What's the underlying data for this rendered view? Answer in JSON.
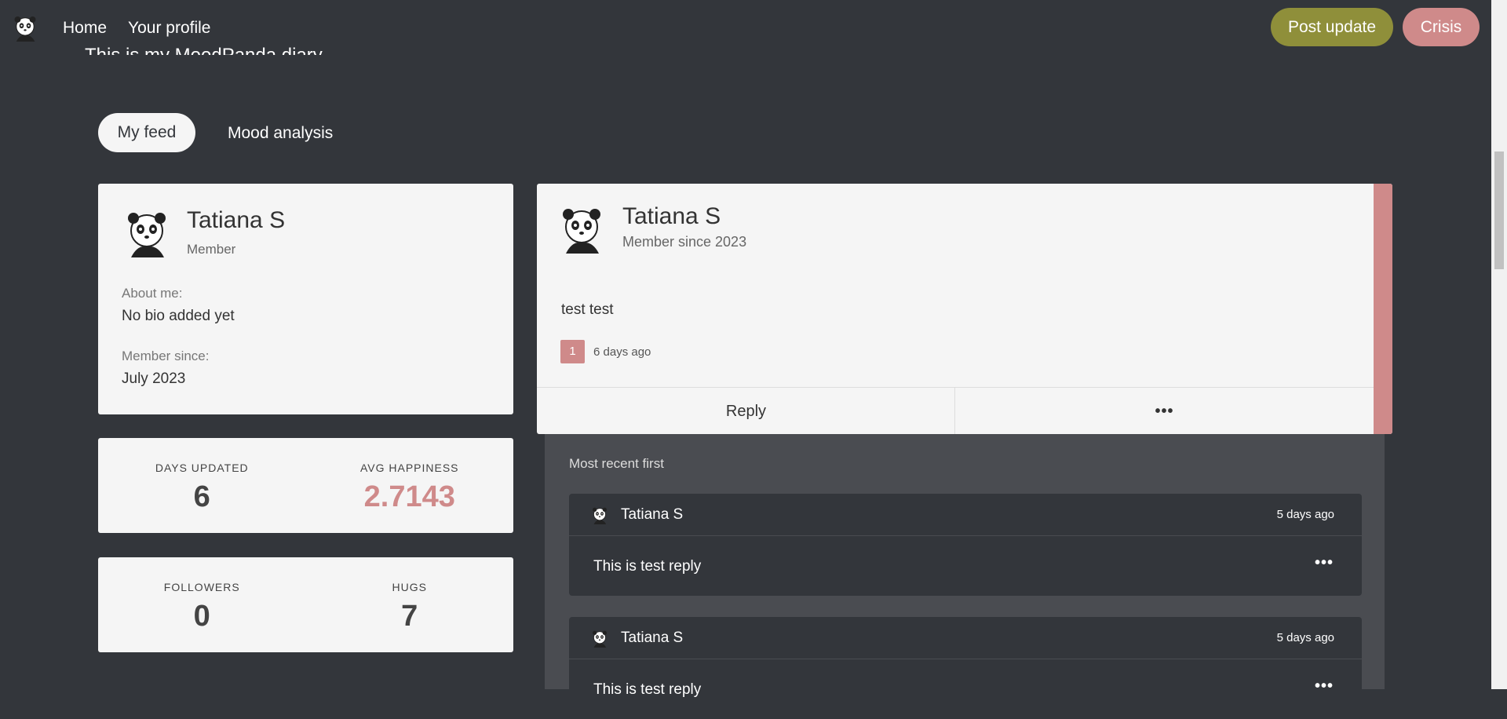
{
  "header": {
    "nav": {
      "home": "Home",
      "profile": "Your profile"
    },
    "post_update": "Post update",
    "crisis": "Crisis"
  },
  "diary_title": "This is my MoodPanda diary",
  "tabs": {
    "feed": "My feed",
    "analysis": "Mood analysis"
  },
  "profile": {
    "name": "Tatiana S",
    "role": "Member",
    "about_label": "About me:",
    "about_value": "No bio added yet",
    "since_label": "Member since:",
    "since_value": "July 2023"
  },
  "stats": {
    "days_updated_label": "DAYS UPDATED",
    "days_updated": "6",
    "avg_happiness_label": "AVG HAPPINESS",
    "avg_happiness": "2.7143",
    "followers_label": "FOLLOWERS",
    "followers": "0",
    "hugs_label": "HUGS",
    "hugs": "7"
  },
  "post": {
    "name": "Tatiana S",
    "sub": "Member since 2023",
    "text": "test test",
    "hug_count": "1",
    "time": "6 days ago",
    "reply_label": "Reply",
    "more_label": "•••"
  },
  "replies": {
    "sort_label": "Most recent first",
    "items": [
      {
        "name": "Tatiana S",
        "time": "5 days ago",
        "text": "This is test reply",
        "more": "•••"
      },
      {
        "name": "Tatiana S",
        "time": "5 days ago",
        "text": "This is test reply",
        "more": "•••"
      }
    ]
  },
  "colors": {
    "accent_green": "#8f8f3a",
    "accent_pink": "#cf8a8a",
    "background": "#33363b"
  }
}
